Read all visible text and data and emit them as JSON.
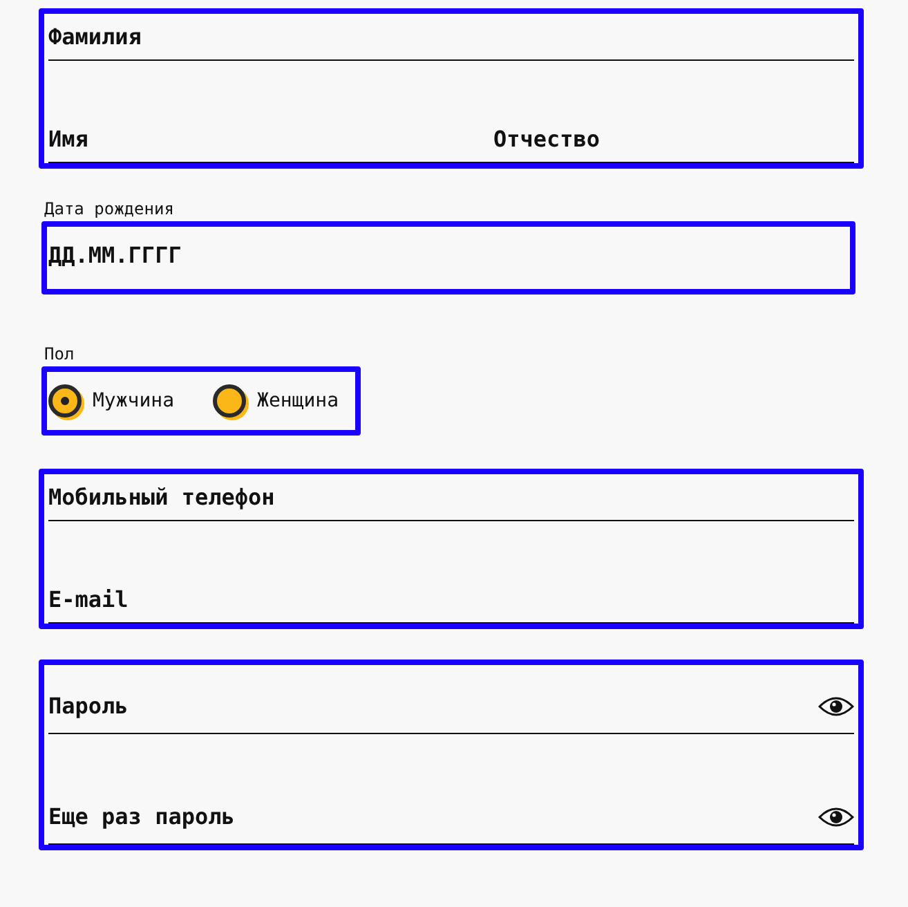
{
  "sections": [
    {
      "kind": "fields",
      "rows": [
        [
          {
            "placeholder": "Фамилия",
            "reveal": false
          }
        ],
        [
          {
            "placeholder": "Имя",
            "reveal": false
          },
          {
            "placeholder": "Отчество",
            "reveal": false
          }
        ]
      ]
    },
    {
      "kind": "date",
      "label": "Дата рождения",
      "placeholder": "ДД.ММ.ГГГГ"
    },
    {
      "kind": "radio",
      "label": "Пол",
      "options": [
        {
          "label": "Мужчина",
          "selected": true
        },
        {
          "label": "Женщина",
          "selected": false
        }
      ]
    },
    {
      "kind": "fields",
      "rows": [
        [
          {
            "placeholder": "Мобильный телефон",
            "reveal": false
          }
        ],
        [
          {
            "placeholder": "E-mail",
            "reveal": false
          }
        ]
      ]
    },
    {
      "kind": "passwords",
      "rows": [
        [
          {
            "placeholder": "Пароль",
            "reveal": true
          }
        ],
        [
          {
            "placeholder": "Еще раз пароль",
            "reveal": true
          }
        ]
      ]
    }
  ]
}
